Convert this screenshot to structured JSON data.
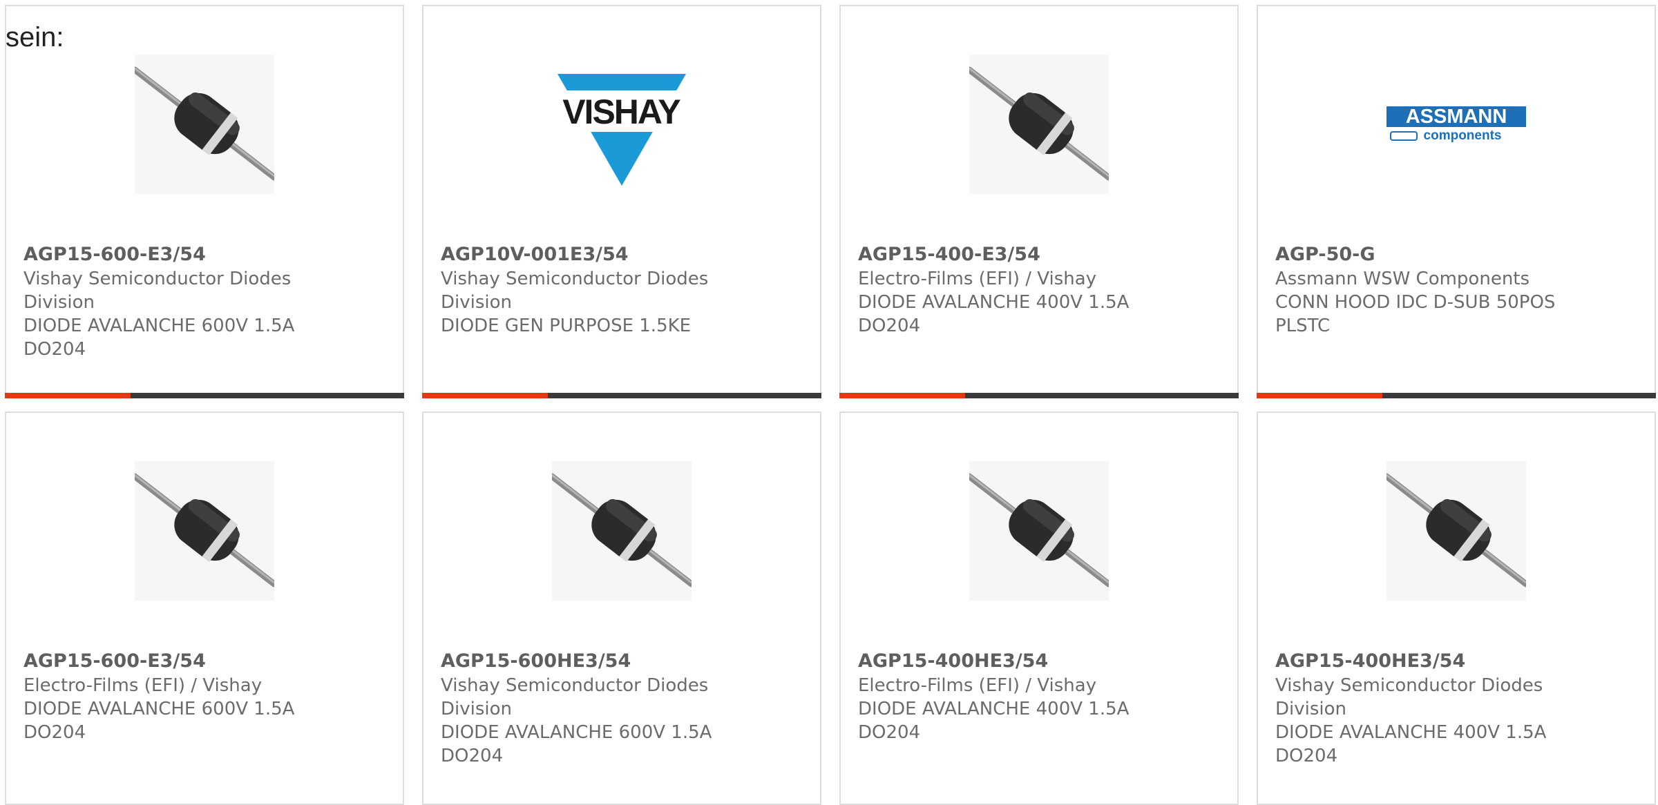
{
  "intro_text": "sein:",
  "colors": {
    "accent": "#e03a12",
    "bar": "#3a3a3a",
    "border": "#dddddd",
    "vishay_blue": "#1a9ad6",
    "assmann_blue": "#1d6fb8"
  },
  "products": [
    {
      "part_number": "AGP15-600-E3/54",
      "manufacturer": "Vishay Semiconductor Diodes Division",
      "description": "DIODE AVALANCHE 600V 1.5A DO204",
      "image": "diode-icon"
    },
    {
      "part_number": "AGP10V-001E3/54",
      "manufacturer": "Vishay Semiconductor Diodes Division",
      "description": "DIODE GEN PURPOSE 1.5KE",
      "image": "vishay-logo",
      "logo_text": "VISHAY"
    },
    {
      "part_number": "AGP15-400-E3/54",
      "manufacturer": "Electro-Films (EFI) / Vishay",
      "description": "DIODE AVALANCHE 400V 1.5A DO204",
      "image": "diode-icon"
    },
    {
      "part_number": "AGP-50-G",
      "manufacturer": "Assmann WSW Components",
      "description": "CONN HOOD IDC D-SUB 50POS PLSTC",
      "image": "assmann-logo",
      "logo_text": "ASSMANN",
      "logo_subtext": "components"
    },
    {
      "part_number": "AGP15-600-E3/54",
      "manufacturer": "Electro-Films (EFI) / Vishay",
      "description": "DIODE AVALANCHE 600V 1.5A DO204",
      "image": "diode-icon"
    },
    {
      "part_number": "AGP15-600HE3/54",
      "manufacturer": "Vishay Semiconductor Diodes Division",
      "description": "DIODE AVALANCHE 600V 1.5A DO204",
      "image": "diode-icon"
    },
    {
      "part_number": "AGP15-400HE3/54",
      "manufacturer": "Electro-Films (EFI) / Vishay",
      "description": "DIODE AVALANCHE 400V 1.5A DO204",
      "image": "diode-icon"
    },
    {
      "part_number": "AGP15-400HE3/54",
      "manufacturer": "Vishay Semiconductor Diodes Division",
      "description": "DIODE AVALANCHE 400V 1.5A DO204",
      "image": "diode-icon"
    }
  ]
}
